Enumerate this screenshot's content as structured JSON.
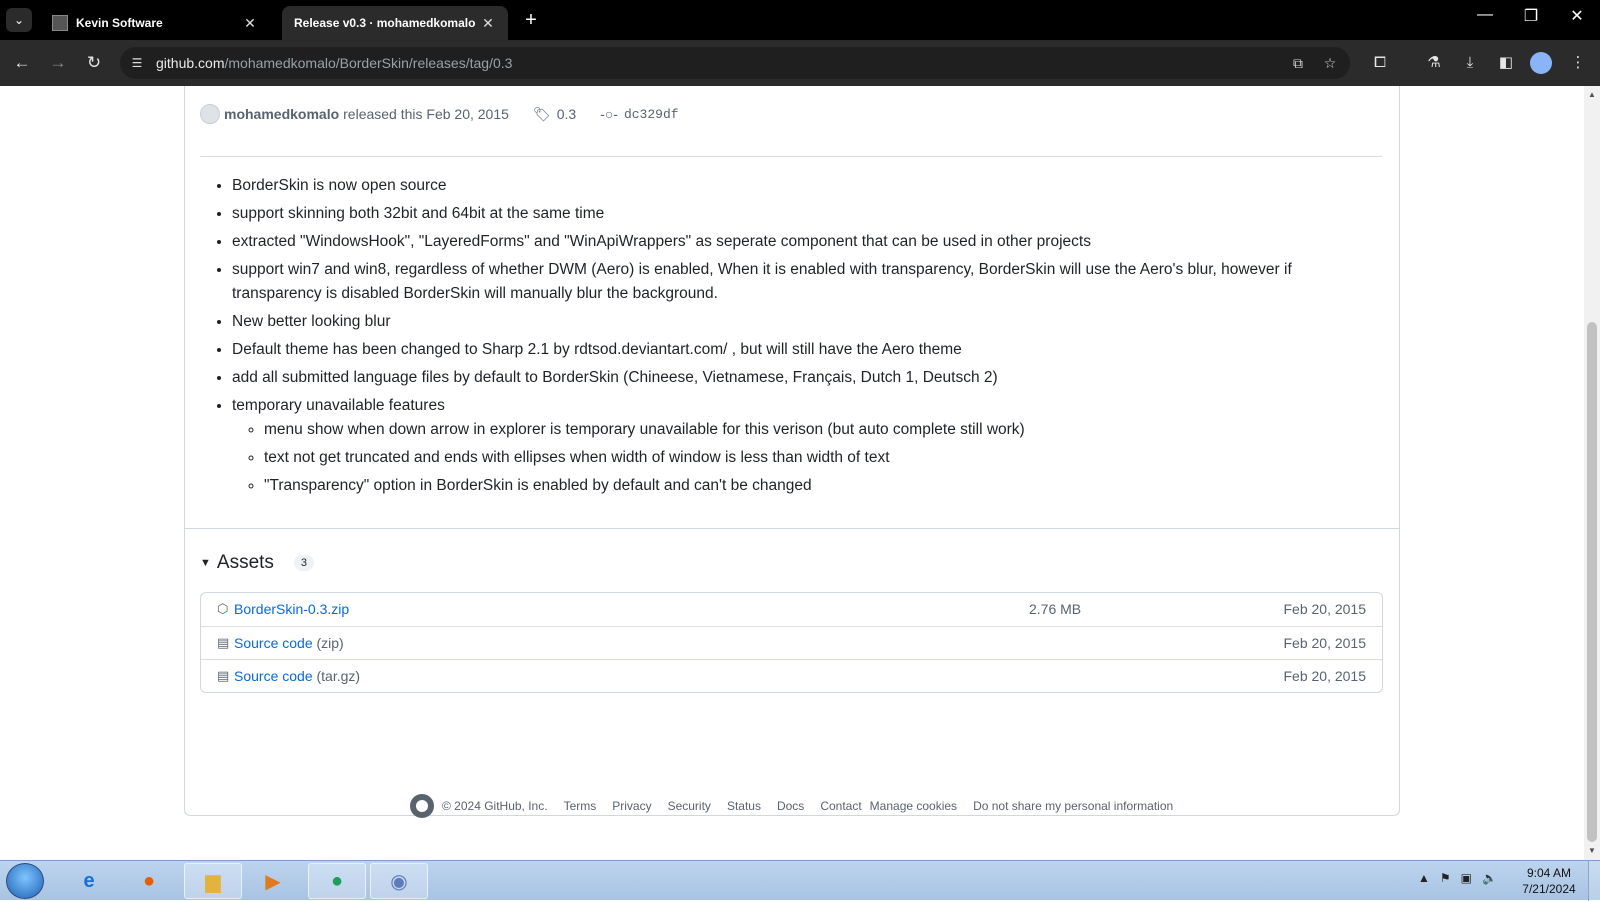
{
  "browser": {
    "tabs": [
      {
        "title": "Kevin Software",
        "active": false
      },
      {
        "title": "Release v0.3 · mohamedkomalo",
        "active": true
      }
    ],
    "url": {
      "host": "github.com",
      "path": "/mohamedkomalo/BorderSkin/releases/tag/0.3"
    }
  },
  "release": {
    "author": "mohamedkomalo",
    "released_text": "released this Feb 20, 2015",
    "tag": "0.3",
    "commit": "dc329df",
    "notes": [
      "BorderSkin is now open source",
      "support skinning both 32bit and 64bit at the same time",
      "extracted \"WindowsHook\", \"LayeredForms\" and \"WinApiWrappers\" as seperate component that can be used in other projects",
      "support win7 and win8, regardless of whether DWM (Aero) is enabled, When it is enabled with transparency, BorderSkin will use the Aero's blur, however if transparency is disabled BorderSkin will manually blur the background.",
      "New better looking blur",
      "Default theme has been changed to Sharp 2.1 by rdtsod.deviantart.com/ , but will still have the Aero theme",
      "add all submitted language files by default to BorderSkin (Chineese, Vietnamese, Français, Dutch 1, Deutsch 2)",
      "temporary unavailable features"
    ],
    "subnotes": [
      "menu show when down arrow in explorer is temporary unavailable for this verison (but auto complete still work)",
      "text not get truncated and ends with ellipses when width of window is less than width of text",
      "\"Transparency\" option in BorderSkin is enabled by default and can't be changed"
    ]
  },
  "assets": {
    "title": "Assets",
    "count": "3",
    "items": [
      {
        "name": "BorderSkin-0.3.zip",
        "suffix": "",
        "size": "2.76 MB",
        "date": "Feb 20, 2015",
        "icon": "package-icon"
      },
      {
        "name": "Source code",
        "suffix": "(zip)",
        "size": "",
        "date": "Feb 20, 2015",
        "icon": "file-zip-icon"
      },
      {
        "name": "Source code",
        "suffix": "(tar.gz)",
        "size": "",
        "date": "Feb 20, 2015",
        "icon": "file-zip-icon"
      }
    ]
  },
  "footer": {
    "copyright": "© 2024 GitHub, Inc.",
    "links": [
      "Terms",
      "Privacy",
      "Security",
      "Status",
      "Docs",
      "Contact",
      "Manage cookies",
      "Do not share my personal information"
    ]
  },
  "taskbar": {
    "time": "9:04 AM",
    "date": "7/21/2024"
  }
}
